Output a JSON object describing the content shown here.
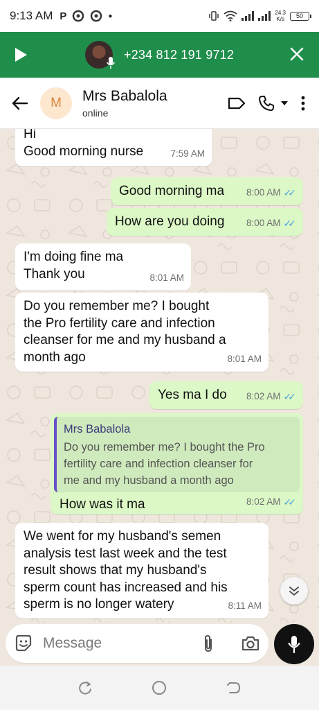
{
  "status_bar": {
    "time": "9:13 AM",
    "app_letter": "P",
    "net_speed_value": "24.3",
    "net_speed_unit": "K/s",
    "battery": "50"
  },
  "call_bar": {
    "phone_number": "+234 812 191 9712"
  },
  "header": {
    "avatar_initial": "M",
    "contact_name": "Mrs Babalola",
    "status": "online"
  },
  "messages": [
    {
      "dir": "in",
      "lines": [
        "Hi",
        "Good morning nurse"
      ],
      "time": "7:59 AM"
    },
    {
      "dir": "out",
      "lines": [
        "Good morning ma"
      ],
      "time": "8:00 AM"
    },
    {
      "dir": "out",
      "lines": [
        "How are you doing"
      ],
      "time": "8:00 AM"
    },
    {
      "dir": "in",
      "lines": [
        "I'm doing fine ma",
        "Thank you"
      ],
      "time": "8:01 AM"
    },
    {
      "dir": "in",
      "lines": [
        "Do you remember me? I bought",
        "the Pro fertility care and infection",
        "cleanser for me and my husband a",
        "month ago"
      ],
      "time": "8:01 AM"
    },
    {
      "dir": "out",
      "lines": [
        "Yes ma I do"
      ],
      "time": "8:02 AM"
    },
    {
      "dir": "out",
      "quote_name": "Mrs Babalola",
      "quote_lines": [
        "Do you remember me? I bought the Pro",
        "fertility care and infection cleanser for",
        "me and my husband a month ago"
      ],
      "lines": [
        "How was it ma"
      ],
      "time": "8:02 AM"
    },
    {
      "dir": "in",
      "lines": [
        "We went for my husband's semen",
        "analysis test last week and the test",
        "result shows that my husband's",
        "sperm count has increased and his",
        "sperm is no longer watery"
      ],
      "time": "8:11 AM"
    }
  ],
  "composer": {
    "placeholder": "Message"
  },
  "colors": {
    "call_bar": "#1f8e4b",
    "outgoing_bubble": "#dcf8c6",
    "incoming_bubble": "#ffffff",
    "read_ticks": "#4fa4e0",
    "chat_background": "#efe7de"
  }
}
